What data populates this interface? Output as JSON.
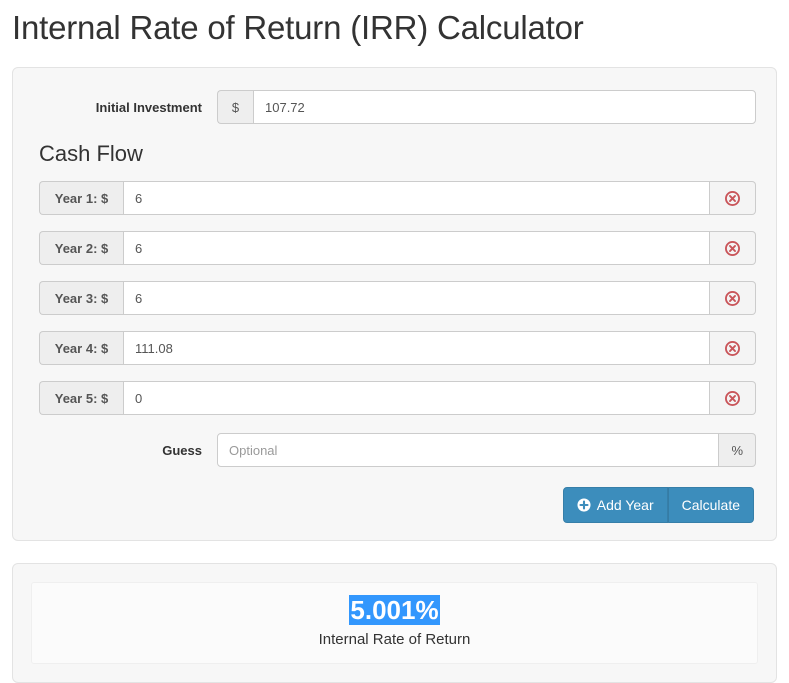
{
  "page": {
    "title": "Internal Rate of Return (IRR) Calculator"
  },
  "form": {
    "initial_investment": {
      "label": "Initial Investment",
      "currency_addon": "$",
      "value": "107.72"
    },
    "cash_flow_heading": "Cash Flow",
    "years": [
      {
        "label": "Year 1: $",
        "value": "6",
        "remove_icon": "remove-circle-icon"
      },
      {
        "label": "Year 2: $",
        "value": "6",
        "remove_icon": "remove-circle-icon"
      },
      {
        "label": "Year 3: $",
        "value": "6",
        "remove_icon": "remove-circle-icon"
      },
      {
        "label": "Year 4: $",
        "value": "111.08",
        "remove_icon": "remove-circle-icon"
      },
      {
        "label": "Year 5: $",
        "value": "0",
        "remove_icon": "remove-circle-icon"
      }
    ],
    "guess": {
      "label": "Guess",
      "placeholder": "Optional",
      "value": "",
      "percent_addon": "%"
    },
    "buttons": {
      "add_year": "Add Year",
      "add_year_icon": "plus-circle-icon",
      "calculate": "Calculate"
    }
  },
  "result": {
    "value": "5.001%",
    "caption": "Internal Rate of Return",
    "selection_color": "#3297fd"
  },
  "colors": {
    "button_blue": "#3c8dbc",
    "remove_red": "#c9555a",
    "panel_bg": "#f7f7f7",
    "panel_border": "#e3e3e3",
    "addon_bg": "#eeeeee"
  }
}
